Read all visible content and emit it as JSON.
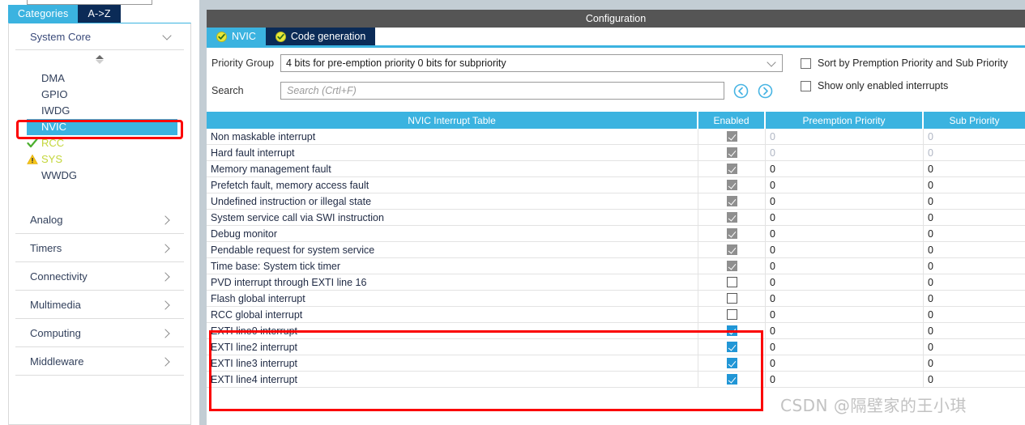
{
  "left_panel": {
    "top_search_placeholder": "",
    "tabs": [
      {
        "label": "Categories",
        "selected": true
      },
      {
        "label": "A->Z",
        "selected": false
      }
    ],
    "category_open": {
      "label": "System Core"
    },
    "peripherals": [
      {
        "label": "DMA",
        "status": "none",
        "selected": false
      },
      {
        "label": "GPIO",
        "status": "none",
        "selected": false
      },
      {
        "label": "IWDG",
        "status": "none",
        "selected": false
      },
      {
        "label": "NVIC",
        "status": "none",
        "selected": true
      },
      {
        "label": "RCC",
        "status": "check",
        "selected": false
      },
      {
        "label": "SYS",
        "status": "warning",
        "selected": false
      },
      {
        "label": "WWDG",
        "status": "none",
        "selected": false
      }
    ],
    "categories": [
      {
        "label": "Analog"
      },
      {
        "label": "Timers"
      },
      {
        "label": "Connectivity"
      },
      {
        "label": "Multimedia"
      },
      {
        "label": "Computing"
      },
      {
        "label": "Middleware"
      }
    ]
  },
  "main": {
    "title": "Configuration",
    "tabs": [
      {
        "label": "NVIC",
        "selected": true,
        "icon": "check-circle-icon"
      },
      {
        "label": "Code generation",
        "selected": false,
        "icon": "check-circle-icon"
      }
    ],
    "priority_group": {
      "label": "Priority Group",
      "value": "4 bits for pre-emption priority 0 bits for subpriority"
    },
    "search": {
      "label": "Search",
      "value": "",
      "placeholder": "Search (Crtl+F)",
      "prev_icon": "prev-circle-icon",
      "next_icon": "next-circle-icon"
    },
    "options": [
      {
        "label": "Sort by Premption Priority and Sub Priority",
        "checked": false
      },
      {
        "label": "Show only enabled interrupts",
        "checked": false
      }
    ],
    "table": {
      "headers": [
        "NVIC Interrupt Table",
        "Enabled",
        "Preemption Priority",
        "Sub Priority"
      ],
      "rows": [
        {
          "name": "Non maskable interrupt",
          "enabled": "checked-disabled",
          "preemption": "0",
          "sub": "0",
          "dim": true,
          "highlight": false
        },
        {
          "name": "Hard fault interrupt",
          "enabled": "checked-disabled",
          "preemption": "0",
          "sub": "0",
          "dim": true,
          "highlight": false
        },
        {
          "name": "Memory management fault",
          "enabled": "checked-disabled",
          "preemption": "0",
          "sub": "0",
          "dim": false,
          "highlight": false
        },
        {
          "name": "Prefetch fault, memory access fault",
          "enabled": "checked-disabled",
          "preemption": "0",
          "sub": "0",
          "dim": false,
          "highlight": false
        },
        {
          "name": "Undefined instruction or illegal state",
          "enabled": "checked-disabled",
          "preemption": "0",
          "sub": "0",
          "dim": false,
          "highlight": false
        },
        {
          "name": "System service call via SWI instruction",
          "enabled": "checked-disabled",
          "preemption": "0",
          "sub": "0",
          "dim": false,
          "highlight": false
        },
        {
          "name": "Debug monitor",
          "enabled": "checked-disabled",
          "preemption": "0",
          "sub": "0",
          "dim": false,
          "highlight": false
        },
        {
          "name": "Pendable request for system service",
          "enabled": "checked-disabled",
          "preemption": "0",
          "sub": "0",
          "dim": false,
          "highlight": false
        },
        {
          "name": "Time base: System tick timer",
          "enabled": "checked-disabled",
          "preemption": "0",
          "sub": "0",
          "dim": false,
          "highlight": false
        },
        {
          "name": "PVD interrupt through EXTI line 16",
          "enabled": "unchecked",
          "preemption": "0",
          "sub": "0",
          "dim": false,
          "highlight": false
        },
        {
          "name": "Flash global interrupt",
          "enabled": "unchecked",
          "preemption": "0",
          "sub": "0",
          "dim": false,
          "highlight": false
        },
        {
          "name": "RCC global interrupt",
          "enabled": "unchecked",
          "preemption": "0",
          "sub": "0",
          "dim": false,
          "highlight": false
        },
        {
          "name": "EXTI line0 interrupt",
          "enabled": "checked-enabled",
          "preemption": "0",
          "sub": "0",
          "dim": false,
          "highlight": true
        },
        {
          "name": "EXTI line2 interrupt",
          "enabled": "checked-enabled",
          "preemption": "0",
          "sub": "0",
          "dim": false,
          "highlight": true
        },
        {
          "name": "EXTI line3 interrupt",
          "enabled": "checked-enabled",
          "preemption": "0",
          "sub": "0",
          "dim": false,
          "highlight": true
        },
        {
          "name": "EXTI line4 interrupt",
          "enabled": "checked-enabled",
          "preemption": "0",
          "sub": "0",
          "dim": false,
          "highlight": true
        }
      ]
    }
  },
  "watermark": {
    "text": "CSDN @隔壁家的王小琪"
  },
  "colors": {
    "accent_blue": "#3bb3e0",
    "tab_dark": "#0b2b57",
    "titlebar_gray": "#555555",
    "highlight_red": "#fb0000",
    "checkbox_enabled": "#2196d6",
    "checkbox_disabled": "#8f8f8f",
    "status_green": "#c3d63a",
    "warn_yellow": "#f5c518"
  }
}
